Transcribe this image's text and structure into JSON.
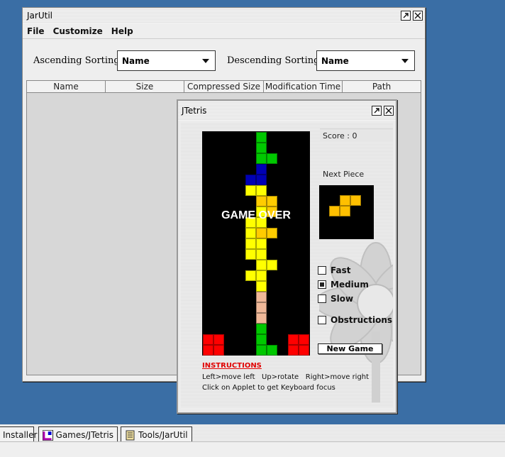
{
  "jarutil": {
    "title": "JarUtil",
    "menu": [
      "File",
      "Customize",
      "Help"
    ],
    "ascending_label": "Ascending Sorting",
    "ascending_value": "Name",
    "descending_label": "Descending Sorting",
    "descending_value": "Name",
    "columns": [
      "Name",
      "Size",
      "Compressed Size",
      "Modification Time",
      "Path"
    ]
  },
  "jtetris": {
    "title": "JTetris",
    "score": "Score : 0",
    "next_label": "Next Piece",
    "game_over": "GAME OVER",
    "options": {
      "fast": "Fast",
      "medium": "Medium",
      "slow": "Slow",
      "obstructions": "Obstructions"
    },
    "selected_speed": "medium",
    "new_game": "New Game",
    "instructions_title": "INSTRUCTIONS",
    "instructions_keys": "Left>move left   Up>rotate   Right>move right",
    "instructions_focus": "Click on Applet to get Keyboard focus",
    "colors": {
      "green": "#00c800",
      "blue": "#0000b4",
      "yellow": "#ffff00",
      "gold": "#ffcc00",
      "peach": "#f0b898",
      "red": "#ff0000",
      "next_piece": "#ffc000"
    }
  },
  "taskbar": {
    "items": [
      "Installer",
      "Games/JTetris",
      "Tools/JarUtil"
    ]
  }
}
